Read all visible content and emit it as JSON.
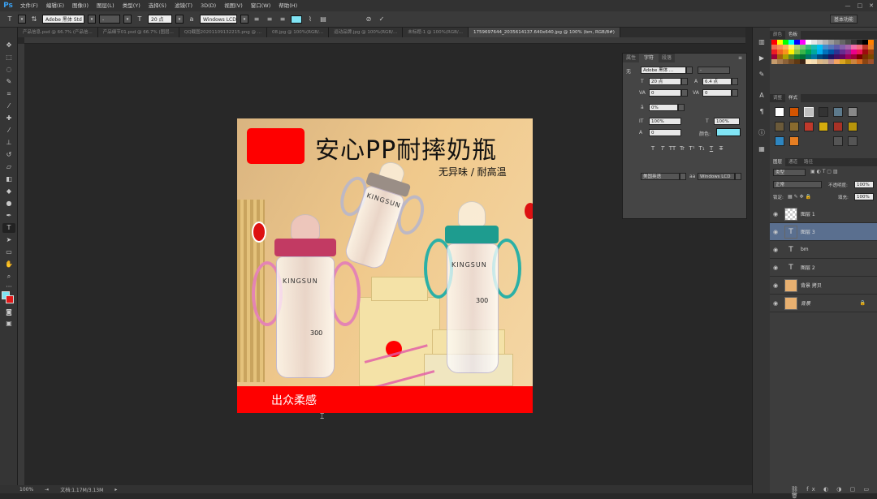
{
  "menu": {
    "logo": "Ps",
    "items": [
      "文件(F)",
      "编辑(E)",
      "图像(I)",
      "图层(L)",
      "类型(Y)",
      "选择(S)",
      "滤镜(T)",
      "3D(D)",
      "视图(V)",
      "窗口(W)",
      "帮助(H)"
    ],
    "win_min": "—",
    "win_max": "□",
    "win_close": "✕"
  },
  "options": {
    "font_family": "Adobe 黑体 Std",
    "font_size": "20 点",
    "antialias": "Windows LCD",
    "text_color": "#80e4f4",
    "workspace": "基本功能"
  },
  "tabs": [
    {
      "label": "产品信息.psd @ 66.7% (产品信...",
      "active": false
    },
    {
      "label": "产品细节01.psd @ 66.7% (图层...",
      "active": false
    },
    {
      "label": "QQ截图20201109132215.png @ ...",
      "active": false
    },
    {
      "label": "08.jpg @ 100%(RGB/...",
      "active": false
    },
    {
      "label": "运动品牌.jpg @ 100%(RGB/...",
      "active": false
    },
    {
      "label": "未标题-1 @ 100%(RGB/...",
      "active": false
    },
    {
      "label": "1759697644_2035614137.640x640.jpg @ 100% (bm, RGB/8#)",
      "active": true
    }
  ],
  "artwork": {
    "headline": "安心PP耐摔奶瓶",
    "subline": "无异味 / 耐高温",
    "band_text": "出众柔感",
    "brand": "KINGSUN",
    "volume": "300"
  },
  "character_panel": {
    "tabs": [
      "属性",
      "字符",
      "段落"
    ],
    "font_family": "Adobe 黑体 ...",
    "font_style": "-",
    "size": "20 点",
    "leading": "6.4 点",
    "kerning": "0",
    "tracking": "0",
    "scale_label": "0%",
    "vscale": "100%",
    "hscale": "100%",
    "color_label": "颜色:",
    "language": "美国英语",
    "antialias": "Windows LCD",
    "type_buttons": [
      "T",
      "T",
      "TT",
      "Tr",
      "T¹",
      "T₁",
      "T",
      "T"
    ],
    "color": "#80e4f4"
  },
  "swatches_panel": {
    "tabs": [
      "颜色",
      "色板"
    ],
    "colors": [
      "#ff0000",
      "#ffff00",
      "#00ff00",
      "#00ffff",
      "#0000ff",
      "#ff00ff",
      "#ffffff",
      "#e6e6e6",
      "#cccccc",
      "#b3b3b3",
      "#999999",
      "#808080",
      "#666666",
      "#4d4d4d",
      "#333333",
      "#1a1a1a",
      "#000000",
      "#ff8000",
      "#f26c4f",
      "#f68e55",
      "#fbaf5c",
      "#fff467",
      "#acd372",
      "#7cc576",
      "#3bb878",
      "#1abbb4",
      "#00bff3",
      "#438ccb",
      "#5574b9",
      "#605ca8",
      "#855fa8",
      "#a763a9",
      "#f06ea9",
      "#f26d7d",
      "#c0392b",
      "#e67e22",
      "#ed1c24",
      "#f26522",
      "#f7941d",
      "#fff200",
      "#8dc63f",
      "#39b54a",
      "#00a651",
      "#00a99d",
      "#00aeef",
      "#0072bc",
      "#0054a6",
      "#2e3192",
      "#662d91",
      "#92278f",
      "#ec008c",
      "#ed145b",
      "#9e0b0f",
      "#a0410d",
      "#9e0039",
      "#a3620a",
      "#aba000",
      "#598527",
      "#1a7b30",
      "#007236",
      "#00746b",
      "#0076a3",
      "#004b80",
      "#003471",
      "#1b1464",
      "#440e62",
      "#630460",
      "#9e005d",
      "#9e0039",
      "#790000",
      "#7b2e00",
      "#7d4900",
      "#c69c6d",
      "#a67c52",
      "#8c6239",
      "#754c24",
      "#603913",
      "#3c2415",
      "#ffe4b5",
      "#f5deb3",
      "#deb887",
      "#d2b48c",
      "#bc8f8f",
      "#f4a460",
      "#daa520",
      "#b8860b",
      "#cd853f",
      "#d2691e",
      "#8b4513",
      "#a0522d"
    ]
  },
  "styles_panel": {
    "tabs": [
      "调整",
      "样式"
    ]
  },
  "layers_panel": {
    "tabs": [
      "图层",
      "通道",
      "路径"
    ],
    "kind": "类型",
    "blend": "正常",
    "opacity_label": "不透明度:",
    "opacity": "100%",
    "lock_label": "锁定:",
    "fill_label": "填充:",
    "fill": "100%",
    "layers": [
      {
        "name": "图层 1",
        "type": "raster",
        "selected": false
      },
      {
        "name": "图层 3",
        "type": "text",
        "selected": true
      },
      {
        "name": "bm",
        "type": "text",
        "selected": false
      },
      {
        "name": "图层 2",
        "type": "text",
        "selected": false
      },
      {
        "name": "背景 拷贝",
        "type": "image",
        "selected": false
      },
      {
        "name": "背景",
        "type": "image",
        "selected": false
      }
    ]
  },
  "status": {
    "zoom": "100%",
    "doc": "文档:1.17M/3.13M"
  }
}
